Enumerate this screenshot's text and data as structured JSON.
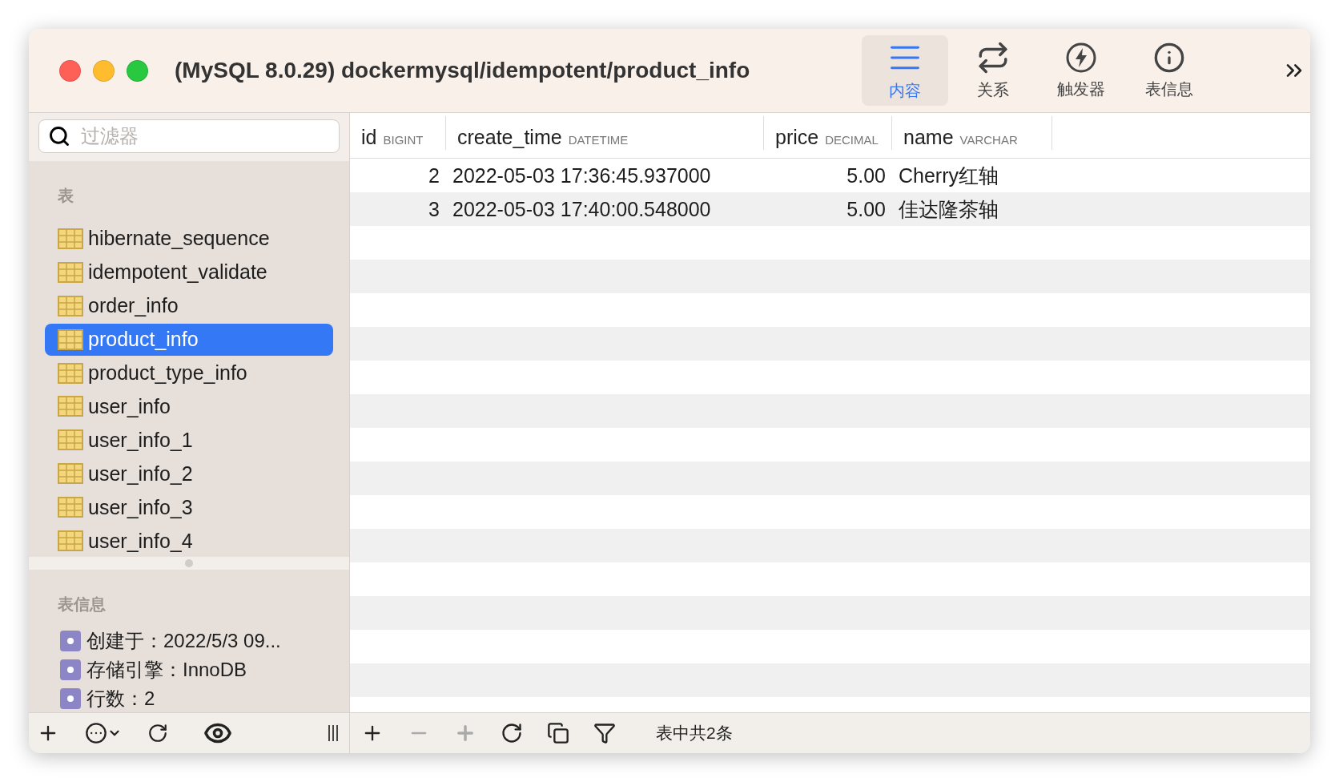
{
  "window": {
    "title": "(MySQL 8.0.29) dockermysql/idempotent/product_info"
  },
  "toolbar": [
    {
      "label": "内容",
      "selected": true
    },
    {
      "label": "关系",
      "selected": false
    },
    {
      "label": "触发器",
      "selected": false
    },
    {
      "label": "表信息",
      "selected": false
    }
  ],
  "sidebar": {
    "search": {
      "placeholder": "过滤器"
    },
    "tables_heading": "表",
    "tables": [
      {
        "label": "hibernate_sequence",
        "selected": false
      },
      {
        "label": "idempotent_validate",
        "selected": false
      },
      {
        "label": "order_info",
        "selected": false
      },
      {
        "label": "product_info",
        "selected": true
      },
      {
        "label": "product_type_info",
        "selected": false
      },
      {
        "label": "user_info",
        "selected": false
      },
      {
        "label": "user_info_1",
        "selected": false
      },
      {
        "label": "user_info_2",
        "selected": false
      },
      {
        "label": "user_info_3",
        "selected": false
      },
      {
        "label": "user_info_4",
        "selected": false
      }
    ],
    "info_heading": "表信息",
    "info": [
      "创建于：2022/5/3 09...",
      "存储引擎：InnoDB",
      "行数：2"
    ]
  },
  "table": {
    "columns": [
      {
        "name": "id",
        "type": "BIGINT"
      },
      {
        "name": "create_time",
        "type": "DATETIME"
      },
      {
        "name": "price",
        "type": "DECIMAL"
      },
      {
        "name": "name",
        "type": "VARCHAR"
      }
    ],
    "rows": [
      [
        "2",
        "2022-05-03 17:36:45.937000",
        "5.00",
        "Cherry红轴"
      ],
      [
        "3",
        "2022-05-03 17:40:00.548000",
        "5.00",
        "佳达隆茶轴"
      ]
    ]
  },
  "bottom_buttons": [
    {
      "kind": "add",
      "disabled": false
    },
    {
      "kind": "remove",
      "disabled": true
    },
    {
      "kind": "duplicate",
      "disabled": true
    },
    {
      "kind": "refresh",
      "disabled": false
    },
    {
      "kind": "copy",
      "disabled": false
    },
    {
      "kind": "filter",
      "disabled": false
    }
  ],
  "status": "表中共2条"
}
